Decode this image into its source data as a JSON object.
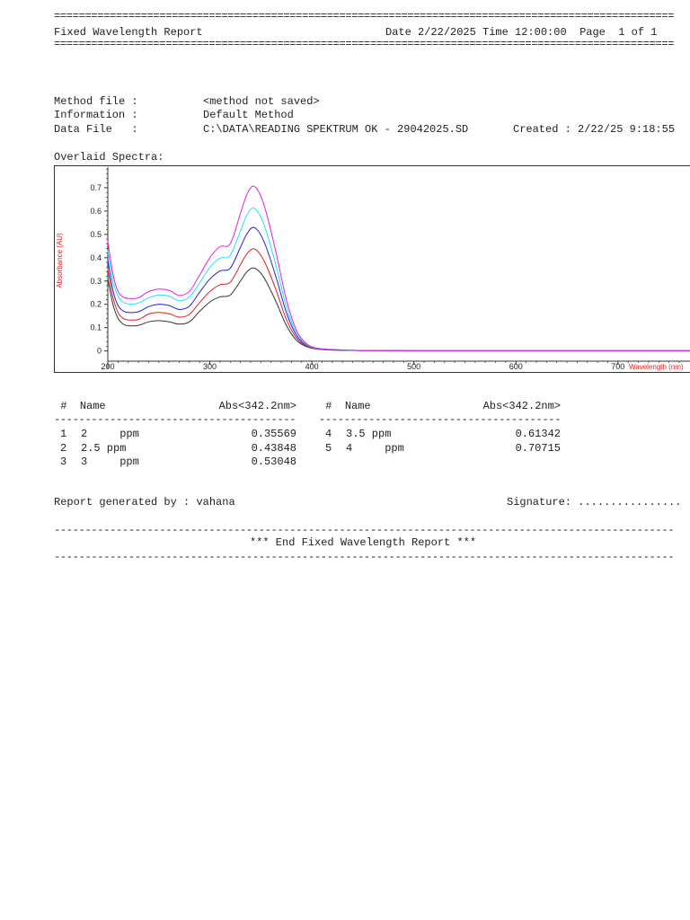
{
  "header": {
    "title": "Fixed Wavelength Report",
    "date_label": "Date",
    "date": "2/22/2025",
    "time_label": "Time",
    "time": "12:00:00",
    "page_label": "Page",
    "page": "1 of 1"
  },
  "info": {
    "method_file_label": "Method file :",
    "method_file": "<method not saved>",
    "information_label": "Information :",
    "information": "Default Method",
    "data_file_label": "Data File   :",
    "data_file": "C:\\DATA\\READING SPEKTRUM OK - 29042025.SD",
    "created_label": "Created :",
    "created": "2/22/25 9:18:55"
  },
  "overlaid_label": "Overlaid Spectra:",
  "chart_data": {
    "type": "line",
    "xlabel": "Wavelength (nm)",
    "ylabel": "Absorbance (AU)",
    "xlim": [
      200,
      790
    ],
    "ylim": [
      -0.04,
      0.75
    ],
    "xticks": [
      200,
      300,
      400,
      500,
      600,
      700
    ],
    "yticks": [
      0,
      0.1,
      0.2,
      0.3,
      0.4,
      0.5,
      0.6,
      0.7
    ],
    "ytick_labels": [
      "0",
      "0.1",
      "0.2",
      "0.3",
      "0.4",
      "0.5",
      "0.6",
      "0.7"
    ],
    "x": [
      200,
      205,
      210,
      215,
      220,
      230,
      240,
      250,
      260,
      270,
      280,
      290,
      300,
      310,
      320,
      330,
      336,
      342,
      348,
      355,
      365,
      375,
      385,
      395,
      405,
      420,
      450,
      500,
      600,
      700,
      790
    ],
    "series": [
      {
        "color": "#333333",
        "values": [
          0.31,
          0.2,
          0.14,
          0.115,
          0.108,
          0.11,
          0.125,
          0.13,
          0.125,
          0.115,
          0.125,
          0.17,
          0.21,
          0.232,
          0.24,
          0.3,
          0.338,
          0.356,
          0.343,
          0.3,
          0.21,
          0.11,
          0.045,
          0.018,
          0.008,
          0.004,
          0.002,
          0.001,
          0.001,
          0.001,
          0.001
        ]
      },
      {
        "color": "#e02020",
        "values": [
          0.35,
          0.23,
          0.165,
          0.14,
          0.133,
          0.135,
          0.158,
          0.165,
          0.16,
          0.145,
          0.157,
          0.208,
          0.255,
          0.284,
          0.295,
          0.37,
          0.415,
          0.438,
          0.422,
          0.37,
          0.26,
          0.135,
          0.055,
          0.02,
          0.009,
          0.005,
          0.002,
          0.001,
          0.001,
          0.001,
          0.001
        ]
      },
      {
        "color": "#2020e0",
        "values": [
          0.39,
          0.26,
          0.195,
          0.172,
          0.165,
          0.168,
          0.19,
          0.2,
          0.195,
          0.178,
          0.192,
          0.252,
          0.308,
          0.343,
          0.355,
          0.445,
          0.5,
          0.53,
          0.511,
          0.448,
          0.315,
          0.165,
          0.066,
          0.024,
          0.01,
          0.005,
          0.002,
          0.001,
          0.001,
          0.001,
          0.001
        ]
      },
      {
        "color": "#20e0ff",
        "values": [
          0.43,
          0.3,
          0.235,
          0.21,
          0.202,
          0.205,
          0.228,
          0.24,
          0.235,
          0.215,
          0.232,
          0.292,
          0.358,
          0.398,
          0.41,
          0.515,
          0.58,
          0.613,
          0.59,
          0.518,
          0.364,
          0.19,
          0.076,
          0.027,
          0.011,
          0.006,
          0.002,
          0.001,
          0.001,
          0.001,
          0.001
        ]
      },
      {
        "color": "#e020e0",
        "values": [
          0.47,
          0.33,
          0.255,
          0.232,
          0.225,
          0.228,
          0.255,
          0.265,
          0.26,
          0.238,
          0.256,
          0.325,
          0.4,
          0.448,
          0.46,
          0.59,
          0.668,
          0.707,
          0.682,
          0.598,
          0.42,
          0.22,
          0.088,
          0.031,
          0.012,
          0.006,
          0.002,
          0.001,
          0.001,
          0.001,
          0.001
        ]
      }
    ]
  },
  "results": {
    "hash": "#",
    "name_header": "Name",
    "abs_header": "Abs<342.2nm>",
    "left_rows": [
      {
        "num": "1",
        "name": "2     ppm",
        "abs": "0.35569"
      },
      {
        "num": "2",
        "name": "2.5 ppm",
        "abs": "0.43848"
      },
      {
        "num": "3",
        "name": "3     ppm",
        "abs": "0.53048"
      }
    ],
    "right_rows": [
      {
        "num": "4",
        "name": "3.5 ppm",
        "abs": "0.61342"
      },
      {
        "num": "5",
        "name": "4     ppm",
        "abs": "0.70715"
      }
    ]
  },
  "footer": {
    "report_by_label": "Report generated by :",
    "report_by": "vahana",
    "signature_label": "Signature:",
    "signature_dots": "................",
    "end_text": "*** End Fixed Wavelength Report ***"
  }
}
